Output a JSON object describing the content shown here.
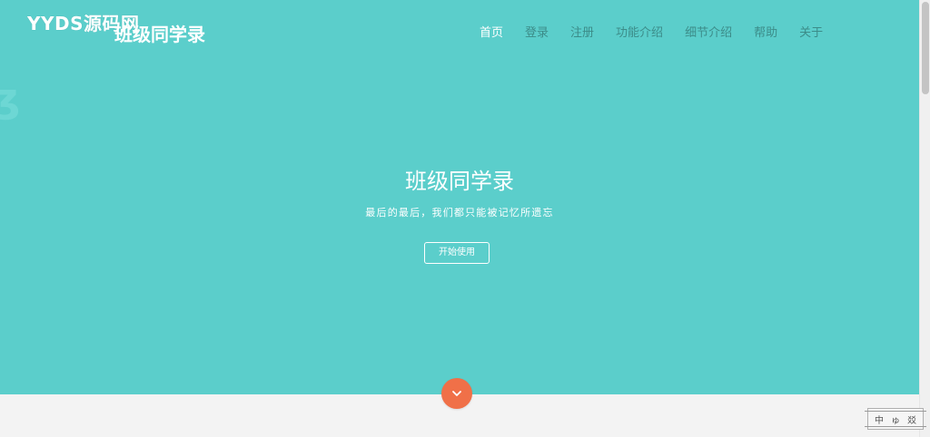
{
  "colors": {
    "hero_bg": "#5bcecb",
    "nav_text": "#3c8c89",
    "nav_active": "#ffffff",
    "accent_button": "#f07048",
    "footer_bg": "#f3f3f3"
  },
  "header": {
    "watermark": "YYDS源码网",
    "brand": "班级同学录"
  },
  "nav": {
    "items": [
      {
        "label": "首页",
        "active": true
      },
      {
        "label": "登录",
        "active": false
      },
      {
        "label": "注册",
        "active": false
      },
      {
        "label": "功能介绍",
        "active": false
      },
      {
        "label": "细节介绍",
        "active": false
      },
      {
        "label": "帮助",
        "active": false
      },
      {
        "label": "关于",
        "active": false
      }
    ]
  },
  "hero": {
    "title": "班级同学录",
    "subtitle": "最后的最后，我们都只能被记忆所遗忘",
    "button_label": "开始使用",
    "scroll_icon": "chevron-down-icon"
  },
  "ime": {
    "chars": [
      "中",
      "ゅ",
      "㸚"
    ]
  }
}
